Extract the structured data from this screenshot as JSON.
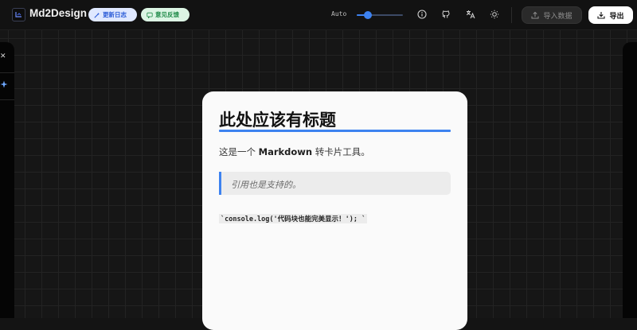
{
  "app": {
    "title": "Md2Design",
    "logo_icon": "markdown-logo-icon"
  },
  "topbar": {
    "changelog_label": "更新日志",
    "feedback_label": "意见反馈",
    "theme_mode_label": "Auto",
    "slider_value_fraction": 0.18,
    "icons": [
      "info-icon",
      "github-icon",
      "translate-icon",
      "sun-icon"
    ],
    "import_label": "导入数据",
    "export_label": "导出"
  },
  "sidebar": {
    "close_glyph": "✕",
    "spark_icon": "sparkle-icon"
  },
  "card": {
    "title": "此处应该有标题",
    "para_prefix": "这是一个 ",
    "para_bold": "Markdown",
    "para_suffix": " 转卡片工具。",
    "quote": "引用也是支持的。",
    "code": "`console.log('代码块也能完美显示！'); `"
  },
  "colors": {
    "accent": "#3d82f0",
    "changelog_bg": "#dfe8ff",
    "feedback_bg": "#dcf5e4"
  }
}
